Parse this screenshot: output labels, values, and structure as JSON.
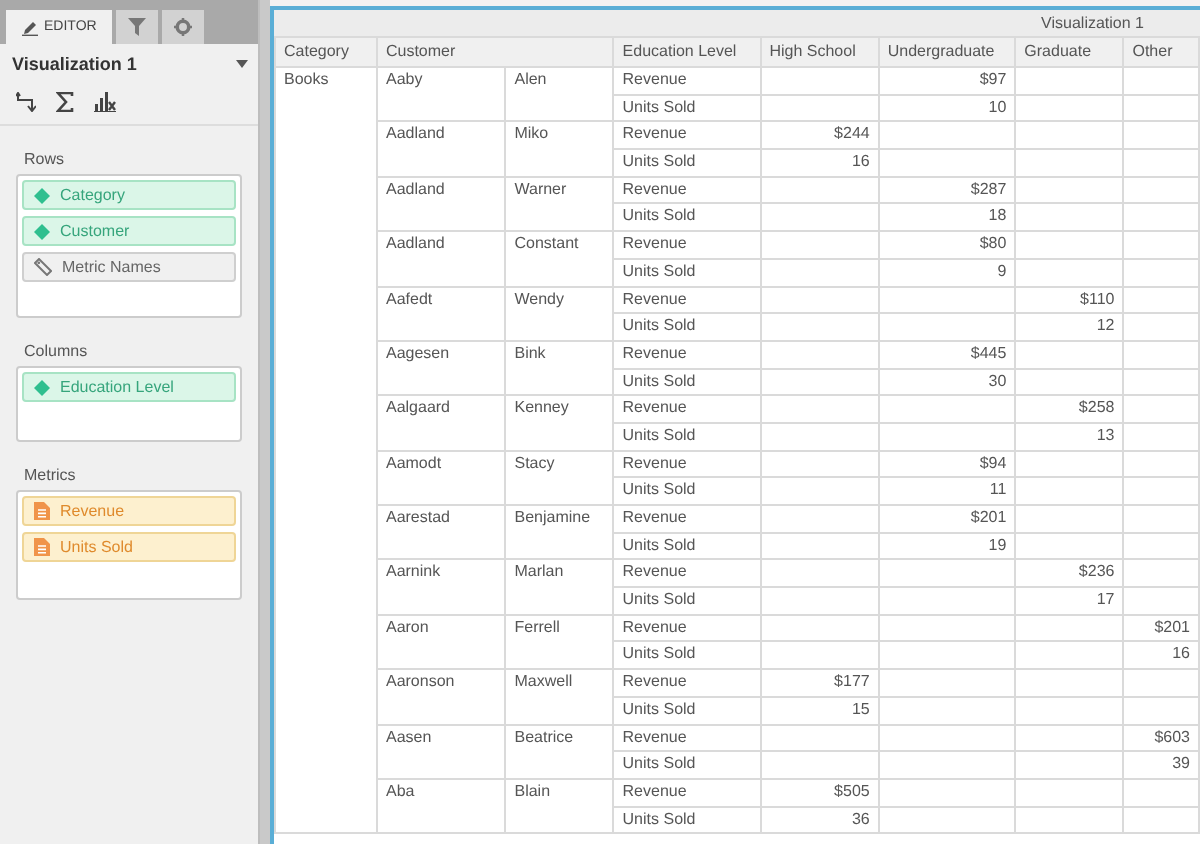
{
  "sidebar": {
    "tabs": [
      {
        "kind": "editor",
        "label": "EDITOR",
        "selected": true
      },
      {
        "kind": "filter",
        "selected": false
      },
      {
        "kind": "settings",
        "selected": false
      }
    ],
    "title": "Visualization 1",
    "drop_zones": [
      {
        "label": "Rows",
        "items": [
          {
            "kind": "attribute",
            "label": "Category"
          },
          {
            "kind": "attribute",
            "label": "Customer"
          },
          {
            "kind": "metric_names",
            "label": "Metric Names"
          }
        ]
      },
      {
        "label": "Columns",
        "items": [
          {
            "kind": "attribute",
            "label": "Education Level"
          }
        ]
      },
      {
        "label": "Metrics",
        "items": [
          {
            "kind": "metric",
            "label": "Revenue"
          },
          {
            "kind": "metric",
            "label": "Units Sold"
          }
        ]
      }
    ]
  },
  "visualization": {
    "title": "Visualization 1",
    "table": {
      "columns": [
        "Category",
        "Customer",
        "Education Level",
        "High School",
        "Undergraduate",
        "Graduate",
        "Other"
      ],
      "category": "Books",
      "customers": [
        {
          "last": "Aaby",
          "first": "Alen",
          "rows": [
            {
              "metric": "Revenue",
              "undergraduate": "$97"
            },
            {
              "metric": "Units Sold",
              "undergraduate": "10"
            }
          ]
        },
        {
          "last": "Aadland",
          "first": "Miko",
          "rows": [
            {
              "metric": "Revenue",
              "high_school": "$244"
            },
            {
              "metric": "Units Sold",
              "high_school": "16"
            }
          ]
        },
        {
          "last": "Aadland",
          "first": "Warner",
          "rows": [
            {
              "metric": "Revenue",
              "undergraduate": "$287"
            },
            {
              "metric": "Units Sold",
              "undergraduate": "18"
            }
          ]
        },
        {
          "last": "Aadland",
          "first": "Constant",
          "rows": [
            {
              "metric": "Revenue",
              "undergraduate": "$80"
            },
            {
              "metric": "Units Sold",
              "undergraduate": "9"
            }
          ]
        },
        {
          "last": "Aafedt",
          "first": "Wendy",
          "rows": [
            {
              "metric": "Revenue",
              "graduate": "$110"
            },
            {
              "metric": "Units Sold",
              "graduate": "12"
            }
          ]
        },
        {
          "last": "Aagesen",
          "first": "Bink",
          "rows": [
            {
              "metric": "Revenue",
              "undergraduate": "$445"
            },
            {
              "metric": "Units Sold",
              "undergraduate": "30"
            }
          ]
        },
        {
          "last": "Aalgaard",
          "first": "Kenney",
          "rows": [
            {
              "metric": "Revenue",
              "graduate": "$258"
            },
            {
              "metric": "Units Sold",
              "graduate": "13"
            }
          ]
        },
        {
          "last": "Aamodt",
          "first": "Stacy",
          "rows": [
            {
              "metric": "Revenue",
              "undergraduate": "$94"
            },
            {
              "metric": "Units Sold",
              "undergraduate": "11"
            }
          ]
        },
        {
          "last": "Aarestad",
          "first": "Benjamine",
          "rows": [
            {
              "metric": "Revenue",
              "undergraduate": "$201"
            },
            {
              "metric": "Units Sold",
              "undergraduate": "19"
            }
          ]
        },
        {
          "last": "Aarnink",
          "first": "Marlan",
          "rows": [
            {
              "metric": "Revenue",
              "graduate": "$236"
            },
            {
              "metric": "Units Sold",
              "graduate": "17"
            }
          ]
        },
        {
          "last": "Aaron",
          "first": "Ferrell",
          "rows": [
            {
              "metric": "Revenue",
              "other": "$201"
            },
            {
              "metric": "Units Sold",
              "other": "16"
            }
          ]
        },
        {
          "last": "Aaronson",
          "first": "Maxwell",
          "rows": [
            {
              "metric": "Revenue",
              "high_school": "$177"
            },
            {
              "metric": "Units Sold",
              "high_school": "15"
            }
          ]
        },
        {
          "last": "Aasen",
          "first": "Beatrice",
          "rows": [
            {
              "metric": "Revenue",
              "other": "$603"
            },
            {
              "metric": "Units Sold",
              "other": "39"
            }
          ]
        },
        {
          "last": "Aba",
          "first": "Blain",
          "rows": [
            {
              "metric": "Revenue",
              "high_school": "$505"
            },
            {
              "metric": "Units Sold",
              "high_school": "36"
            }
          ]
        }
      ]
    }
  }
}
